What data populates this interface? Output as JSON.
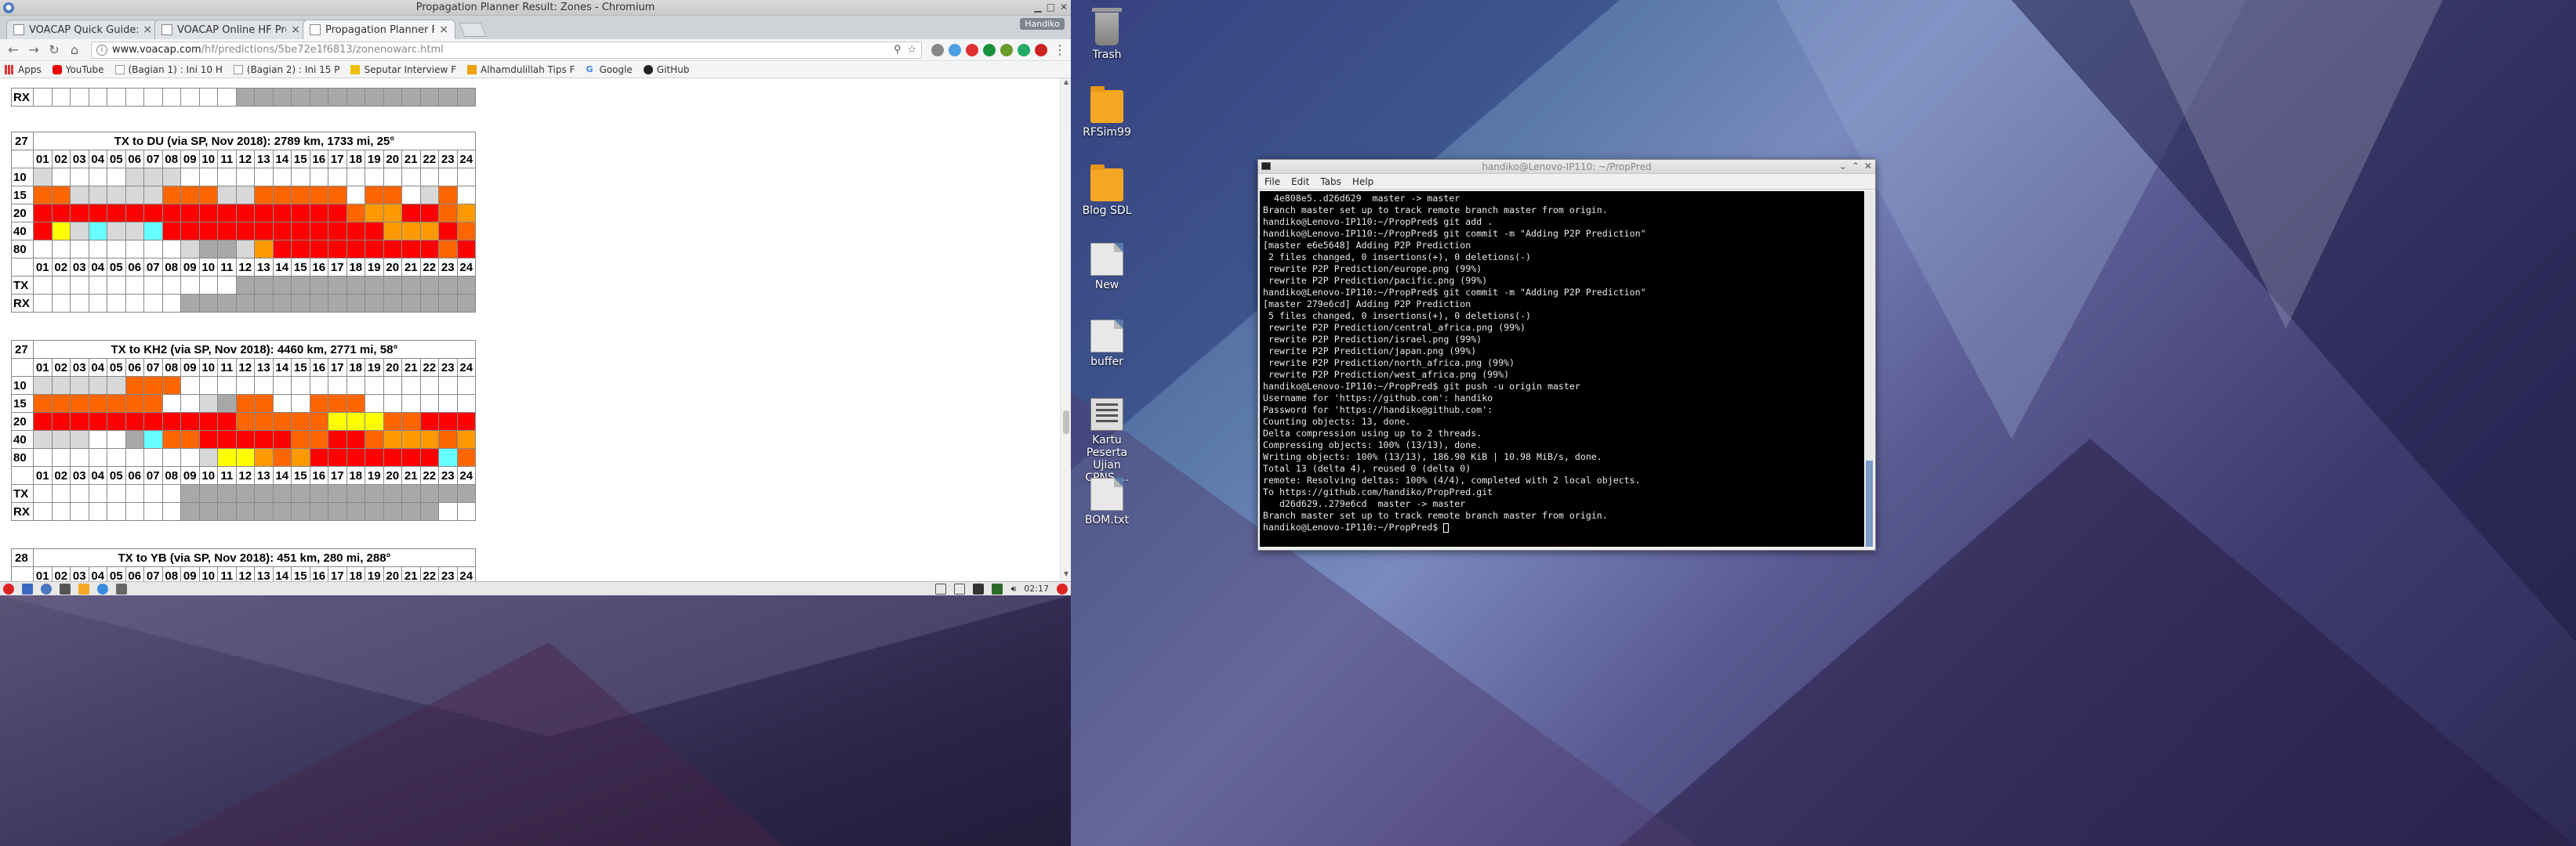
{
  "left_screen": {
    "chrome": {
      "window_title": "Propagation Planner Result: Zones - Chromium",
      "profile_label": "Handiko",
      "tabs": [
        {
          "title": "VOACAP Quick Guide: H",
          "active": false
        },
        {
          "title": "VOACAP Online HF Pred",
          "active": false
        },
        {
          "title": "Propagation Planner Re",
          "active": true
        }
      ],
      "url_host": "www.voacap.com",
      "url_path": "/hf/predictions/5be72e1f6813/zonenowarc.html",
      "bookmarks": [
        {
          "label": "Apps",
          "icon": "apps-grid-icon"
        },
        {
          "label": "YouTube",
          "icon": "youtube-icon"
        },
        {
          "label": "(Bagian 1) : Ini 10 H",
          "icon": "page-icon"
        },
        {
          "label": "(Bagian 2) : Ini 15 P",
          "icon": "page-icon"
        },
        {
          "label": "Seputar Interview F",
          "icon": "page-icon"
        },
        {
          "label": "Alhamdulillah Tips F",
          "icon": "page-icon"
        },
        {
          "label": "Google",
          "icon": "google-icon"
        },
        {
          "label": "GitHub",
          "icon": "github-icon"
        }
      ]
    },
    "page": {
      "hours": [
        "01",
        "02",
        "03",
        "04",
        "05",
        "06",
        "07",
        "08",
        "09",
        "10",
        "11",
        "12",
        "13",
        "14",
        "15",
        "16",
        "17",
        "18",
        "19",
        "20",
        "21",
        "22",
        "23",
        "24"
      ],
      "top_fragment": {
        "rx_label": "RX",
        "rx_row": "wwwwwwwwwwwgggggggggggggwwwww"
      },
      "tables": [
        {
          "number": "27",
          "title": "TX to DU (via SP, Nov 2018): 2789 km, 1733 mi, 25°",
          "rows": [
            {
              "label": "10",
              "cells": "lwwwwlllwwwwwwwwwwwwwwwww"
            },
            {
              "label": "15",
              "cells": "oolllllooollooooowoowlowrr"
            },
            {
              "label": "20",
              "cells": "rrrrrrrrrrrrrrrrroaarroarr"
            },
            {
              "label": "40",
              "cells": "rylcllcrrrrrrrrrrrraaaroorr"
            },
            {
              "label": "80",
              "cells": "wwwwwwwwlgglarrrrrrrrrorry"
            }
          ],
          "tx_label": "TX",
          "rx_label": "RX",
          "tx_row": "wwwwwwwwwwwgggggggggggggwwww",
          "rx_row": "wwwwwwwwgggggggggggggggggwww"
        },
        {
          "number": "27",
          "title": "TX to KH2 (via SP, Nov 2018): 4460 km, 2771 mi, 58°",
          "rows": [
            {
              "label": "10",
              "cells": "lllllooowwwwwwwwwwwwwwwwww"
            },
            {
              "label": "15",
              "cells": "ooooooowwlgoowwooowwwwwwwgo"
            },
            {
              "label": "20",
              "cells": "rrrrrrrrrrroooooyyyoorrrrr"
            },
            {
              "label": "40",
              "cells": "lllwwgcoorrrrroorroaaaoaroo"
            },
            {
              "label": "80",
              "cells": "wwwwwwwwwlyyaoarrrrrrrcorrr"
            }
          ],
          "tx_label": "TX",
          "rx_label": "RX",
          "tx_row": "wwwwwwwwgggggggggggggggggwww",
          "rx_row": "wwwwwwwwggggggggggggggwwwwww"
        },
        {
          "number": "28",
          "title": "TX to YB (via SP, Nov 2018): 451 km, 280 mi, 288°",
          "rows": [],
          "tx_label": "",
          "rx_label": "",
          "tx_row": "",
          "rx_row": ""
        }
      ]
    },
    "taskbar": {
      "clock": "02:17"
    }
  },
  "right_screen": {
    "desktop_icons": [
      {
        "label": "Trash",
        "kind": "trash"
      },
      {
        "label": "RFSim99",
        "kind": "folder"
      },
      {
        "label": "Blog SDL",
        "kind": "folder"
      },
      {
        "label": "New",
        "kind": "file"
      },
      {
        "label": "buffer",
        "kind": "file"
      },
      {
        "label": "Kartu Peserta Ujian CPNS....",
        "kind": "image"
      },
      {
        "label": "BOM.txt",
        "kind": "file"
      }
    ],
    "terminal": {
      "title": "handiko@Lenovo-IP110: ~/PropPred",
      "menu": [
        "File",
        "Edit",
        "Tabs",
        "Help"
      ],
      "lines": [
        "  4e808e5..d26d629  master -> master",
        "Branch master set up to track remote branch master from origin.",
        "handiko@Lenovo-IP110:~/PropPred$ git add .",
        "handiko@Lenovo-IP110:~/PropPred$ git commit -m \"Adding P2P Prediction\"",
        "[master e6e5648] Adding P2P Prediction",
        " 2 files changed, 0 insertions(+), 0 deletions(-)",
        " rewrite P2P Prediction/europe.png (99%)",
        " rewrite P2P Prediction/pacific.png (99%)",
        "handiko@Lenovo-IP110:~/PropPred$ git commit -m \"Adding P2P Prediction\"",
        "[master 279e6cd] Adding P2P Prediction",
        " 5 files changed, 0 insertions(+), 0 deletions(-)",
        " rewrite P2P Prediction/central_africa.png (99%)",
        " rewrite P2P Prediction/israel.png (99%)",
        " rewrite P2P Prediction/japan.png (99%)",
        " rewrite P2P Prediction/north_africa.png (99%)",
        " rewrite P2P Prediction/west_africa.png (99%)",
        "handiko@Lenovo-IP110:~/PropPred$ git push -u origin master",
        "Username for 'https://github.com': handiko",
        "Password for 'https://handiko@github.com':",
        "Counting objects: 13, done.",
        "Delta compression using up to 2 threads.",
        "Compressing objects: 100% (13/13), done.",
        "Writing objects: 100% (13/13), 186.90 KiB | 10.98 MiB/s, done.",
        "Total 13 (delta 4), reused 0 (delta 0)",
        "remote: Resolving deltas: 100% (4/4), completed with 2 local objects.",
        "To https://github.com/handiko/PropPred.git",
        "   d26d629..279e6cd  master -> master",
        "Branch master set up to track remote branch master from origin.",
        "handiko@Lenovo-IP110:~/PropPred$ "
      ]
    }
  },
  "colors": {
    "w": "#ffffff",
    "l": "#d8d8d8",
    "g": "#a8a8a8",
    "r": "#ff0000",
    "o": "#ff6600",
    "a": "#ff9900",
    "y": "#ffff00",
    "c": "#66ffff"
  }
}
